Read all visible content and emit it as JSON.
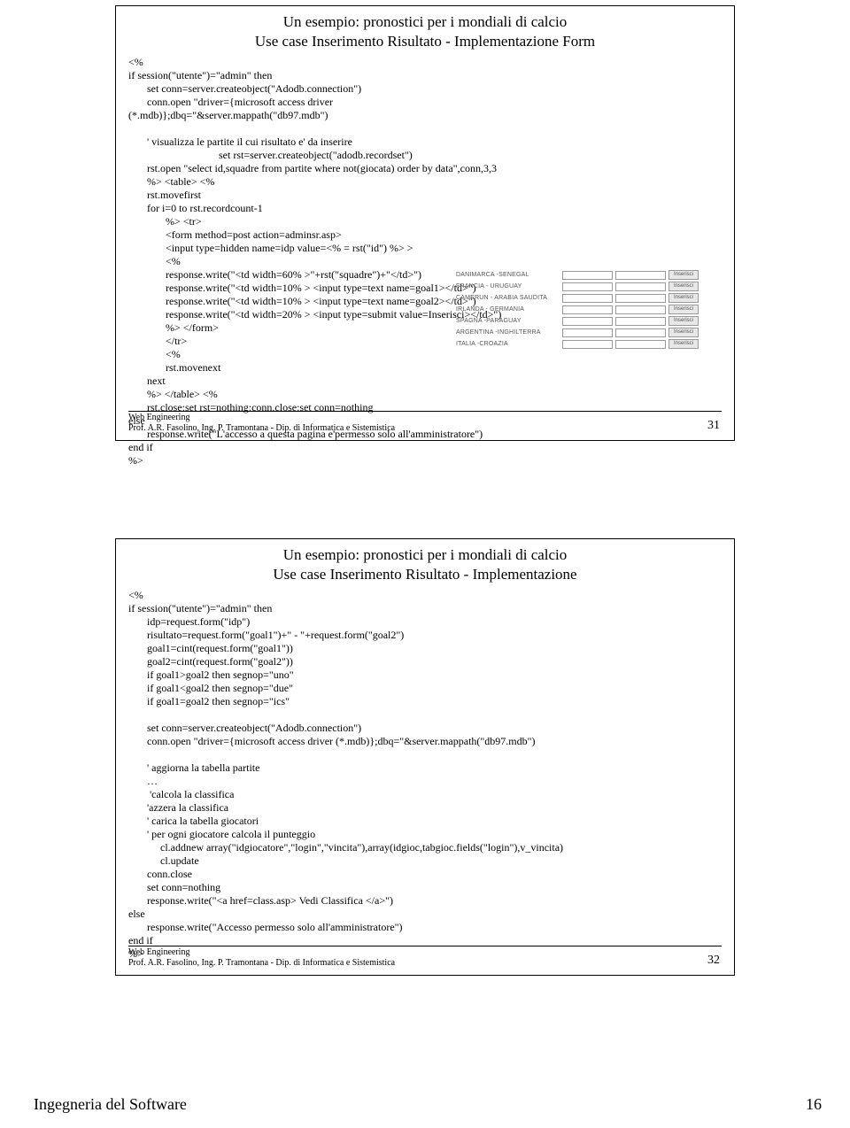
{
  "slide1": {
    "title": "Un esempio: pronostici per i mondiali di calcio",
    "subtitle": "Use case Inserimento Risultato - Implementazione Form",
    "code": "<%\nif session(\"utente\")=\"admin\" then\n       set conn=server.createobject(\"Adodb.connection\")\n       conn.open \"driver={microsoft access driver\n(*.mdb)};dbq=\"&server.mappath(\"db97.mdb\")\n\n       ' visualizza le partite il cui risultato e' da inserire\n                                  set rst=server.createobject(\"adodb.recordset\")\n       rst.open \"select id,squadre from partite where not(giocata) order by data\",conn,3,3\n       %> <table> <%\n       rst.movefirst\n       for i=0 to rst.recordcount-1\n              %> <tr>\n              <form method=post action=adminsr.asp>\n              <input type=hidden name=idp value=<% = rst(\"id\") %> >\n              <%\n              response.write(\"<td width=60% >\"+rst(\"squadre\")+\"</td>\")\n              response.write(\"<td width=10% > <input type=text name=goal1></td>\")\n              response.write(\"<td width=10% > <input type=text name=goal2></td>\")\n              response.write(\"<td width=20% > <input type=submit value=Inserisci></td>\")\n              %> </form>\n              </tr>\n              <%\n              rst.movenext\n       next\n       %> </table> <%\n       rst.close:set rst=nothing:conn.close:set conn=nothing\nelse\n       response.write(\"L'accesso a questa pagina e'permesso solo all'amministratore\")\nend if\n%>",
    "footer1": "Web Engineering",
    "footer2": "Prof. A.R. Fasolino, Ing. P. Tramontana - Dip. di Informatica e Sistemistica",
    "page": "31",
    "matches": [
      {
        "label": "DANIMARCA -SENEGAL",
        "btn": "Inserisci"
      },
      {
        "label": "FRANCIA - URUGUAY",
        "btn": "Inserisci"
      },
      {
        "label": "CAMERUN - ARABIA SAUDITA",
        "btn": "Inserisci"
      },
      {
        "label": "IRLANDA - GERMANIA",
        "btn": "Inserisci"
      },
      {
        "label": "SPAGNA -PARAGUAY",
        "btn": "Inserisci"
      },
      {
        "label": "ARGENTINA -INGHILTERRA",
        "btn": "Inserisci"
      },
      {
        "label": "ITALIA -CROAZIA",
        "btn": "Inserisci"
      }
    ]
  },
  "slide2": {
    "title": "Un esempio: pronostici per i mondiali di calcio",
    "subtitle": "Use case Inserimento Risultato - Implementazione",
    "code": "<%\nif session(\"utente\")=\"admin\" then\n       idp=request.form(\"idp\")\n       risultato=request.form(\"goal1\")+\" - \"+request.form(\"goal2\")\n       goal1=cint(request.form(\"goal1\"))\n       goal2=cint(request.form(\"goal2\"))\n       if goal1>goal2 then segnop=\"uno\"\n       if goal1<goal2 then segnop=\"due\"\n       if goal1=goal2 then segnop=\"ics\"\n\n       set conn=server.createobject(\"Adodb.connection\")\n       conn.open \"driver={microsoft access driver (*.mdb)};dbq=\"&server.mappath(\"db97.mdb\")\n\n       ' aggiorna la tabella partite\n       …\n        'calcola la classifica\n       'azzera la classifica\n       ' carica la tabella giocatori\n       ' per ogni giocatore calcola il punteggio\n            cl.addnew array(\"idgiocatore\",\"login\",\"vincita\"),array(idgioc,tabgioc.fields(\"login\"),v_vincita)\n            cl.update\n       conn.close\n       set conn=nothing\n       response.write(\"<a href=class.asp> Vedi Classifica </a>\")\nelse\n       response.write(\"Accesso permesso solo all'amministratore\")\nend if\n%>",
    "footer1": "Web Engineering",
    "footer2": "Prof. A.R. Fasolino, Ing. P. Tramontana - Dip. di Informatica e Sistemistica",
    "page": "32"
  },
  "pageFooter": {
    "left": "Ingegneria del Software",
    "right": "16"
  }
}
